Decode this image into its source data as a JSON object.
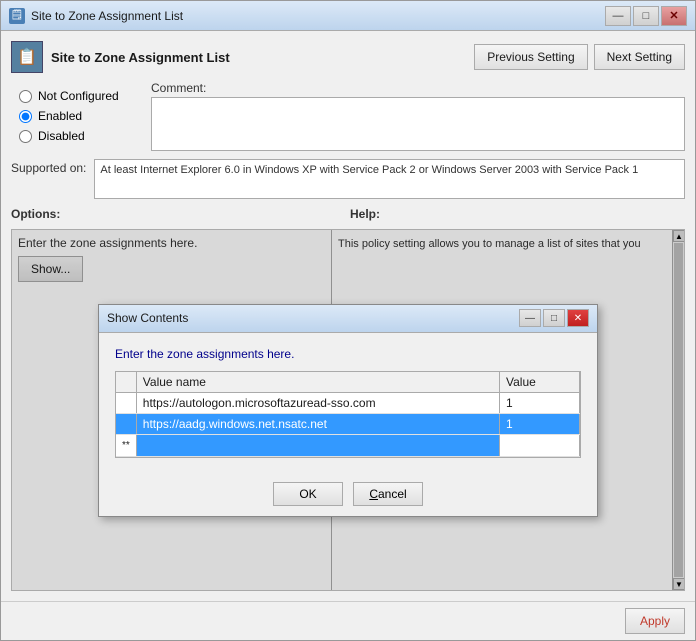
{
  "window": {
    "title": "Site to Zone Assignment List",
    "icon": "🗒"
  },
  "title_buttons": {
    "minimize": "—",
    "maximize": "□",
    "close": "✕"
  },
  "header": {
    "policy_title": "Site to Zone Assignment List",
    "previous_button": "Previous Setting",
    "next_button": "Next Setting"
  },
  "radio_options": {
    "not_configured": "Not Configured",
    "enabled": "Enabled",
    "disabled": "Disabled"
  },
  "comment": {
    "label": "Comment:"
  },
  "supported": {
    "label": "Supported on:",
    "text": "At least Internet Explorer 6.0 in Windows XP with Service Pack 2 or Windows Server 2003 with Service Pack 1"
  },
  "sections": {
    "options": "Options:",
    "help": "Help:"
  },
  "options_pane": {
    "instruction": "Enter the zone assignments here.",
    "show_button": "Show..."
  },
  "help_text": "This policy setting allows you to manage a list of sites that you",
  "scrollbar": {
    "up": "▲",
    "down": "▼"
  },
  "bottom_bar": {
    "apply_button": "Apply"
  },
  "modal": {
    "title": "Show Contents",
    "min_btn": "—",
    "max_btn": "□",
    "close_btn": "✕",
    "instruction": "Enter the zone assignments here.",
    "table": {
      "col_value_name": "Value name",
      "col_value": "Value",
      "rows": [
        {
          "name": "https://autologon.microsoftazuread-sso.com",
          "value": "1",
          "selected": false
        },
        {
          "name": "https://aadg.windows.net.nsatc.net",
          "value": "1",
          "selected": true
        }
      ],
      "empty_row_indicator": "**"
    },
    "ok_button": "OK",
    "cancel_button": "Cancel"
  }
}
